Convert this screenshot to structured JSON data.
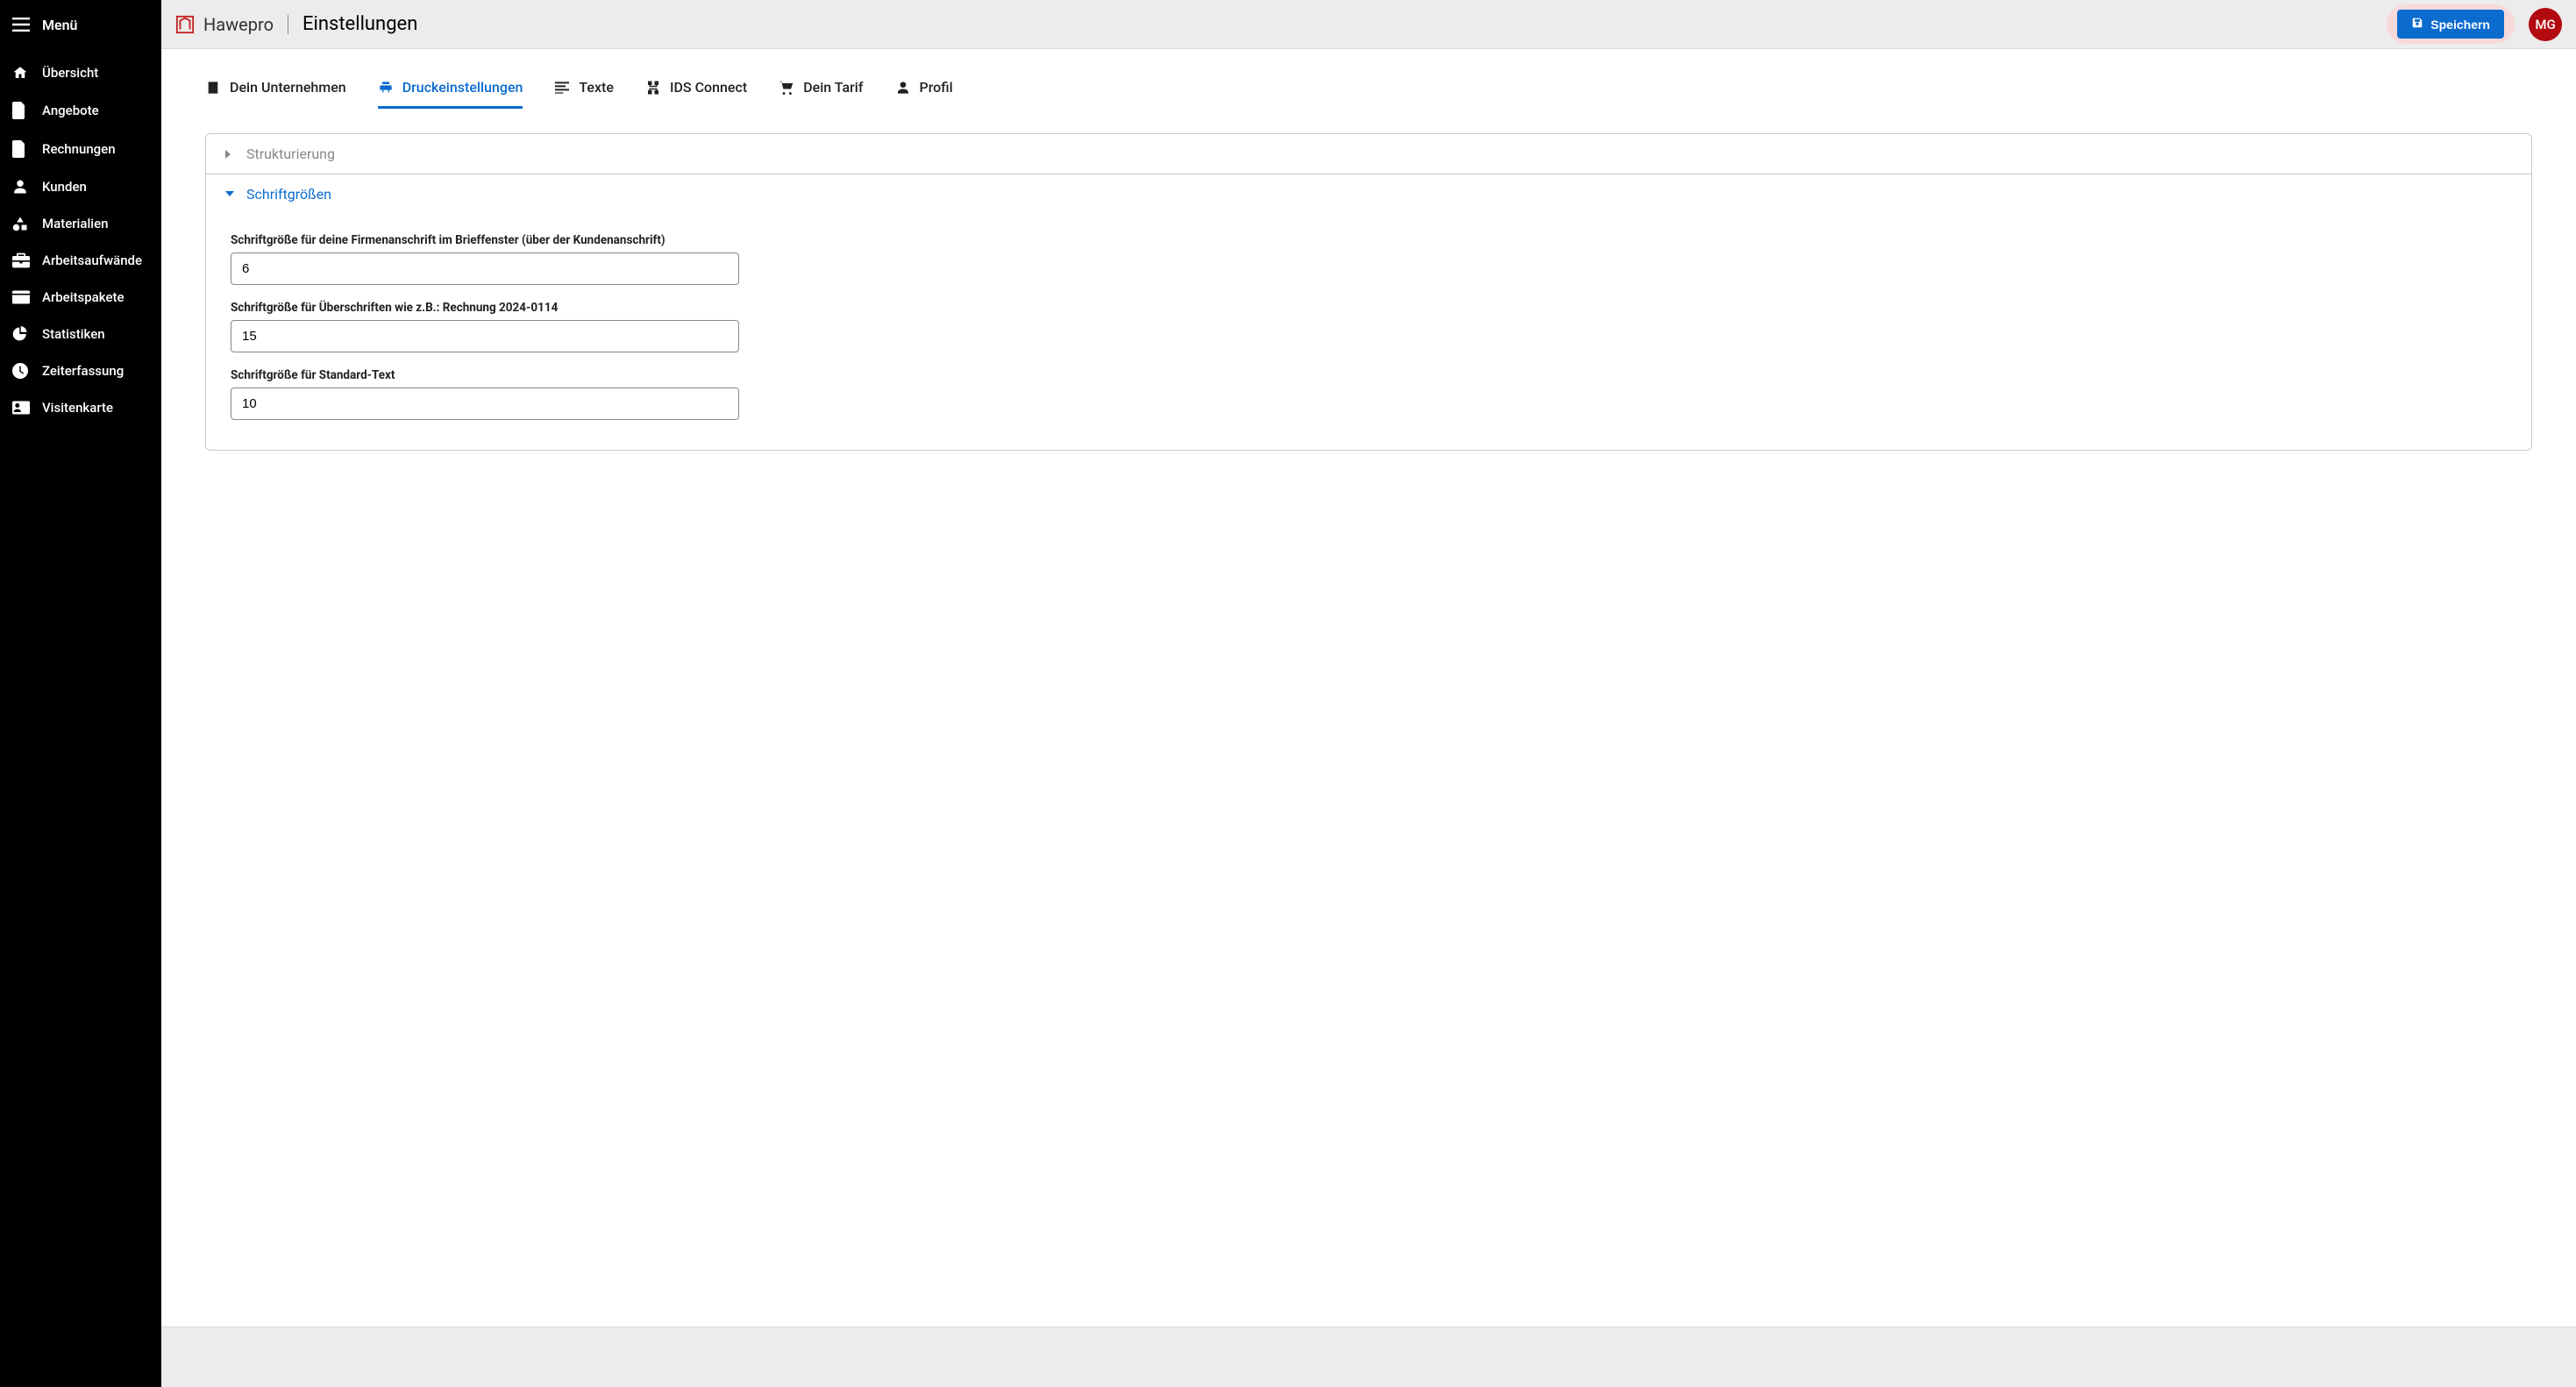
{
  "sidebar": {
    "menu_label": "Menü",
    "items": [
      {
        "label": "Übersicht"
      },
      {
        "label": "Angebote"
      },
      {
        "label": "Rechnungen"
      },
      {
        "label": "Kunden"
      },
      {
        "label": "Materialien"
      },
      {
        "label": "Arbeitsaufwände"
      },
      {
        "label": "Arbeitspakete"
      },
      {
        "label": "Statistiken"
      },
      {
        "label": "Zeiterfassung"
      },
      {
        "label": "Visitenkarte"
      }
    ]
  },
  "header": {
    "brand": "Hawepro",
    "page_title": "Einstellungen",
    "save_label": "Speichern",
    "avatar_initials": "MG"
  },
  "tabs": [
    {
      "label": "Dein Unternehmen",
      "icon": "building-icon",
      "active": false
    },
    {
      "label": "Druckeinstellungen",
      "icon": "print-icon",
      "active": true
    },
    {
      "label": "Texte",
      "icon": "text-lines-icon",
      "active": false
    },
    {
      "label": "IDS Connect",
      "icon": "connect-icon",
      "active": false
    },
    {
      "label": "Dein Tarif",
      "icon": "cart-icon",
      "active": false
    },
    {
      "label": "Profil",
      "icon": "person-icon",
      "active": false
    }
  ],
  "accordion": {
    "collapsed_title": "Strukturierung",
    "expanded_title": "Schriftgrößen",
    "fields": [
      {
        "label": "Schriftgröße für deine Firmenanschrift im Brieffenster (über der Kundenanschrift)",
        "value": "6"
      },
      {
        "label": "Schriftgröße für Überschriften wie z.B.: Rechnung 2024-0114",
        "value": "15"
      },
      {
        "label": "Schriftgröße für Standard-Text",
        "value": "10"
      }
    ]
  }
}
